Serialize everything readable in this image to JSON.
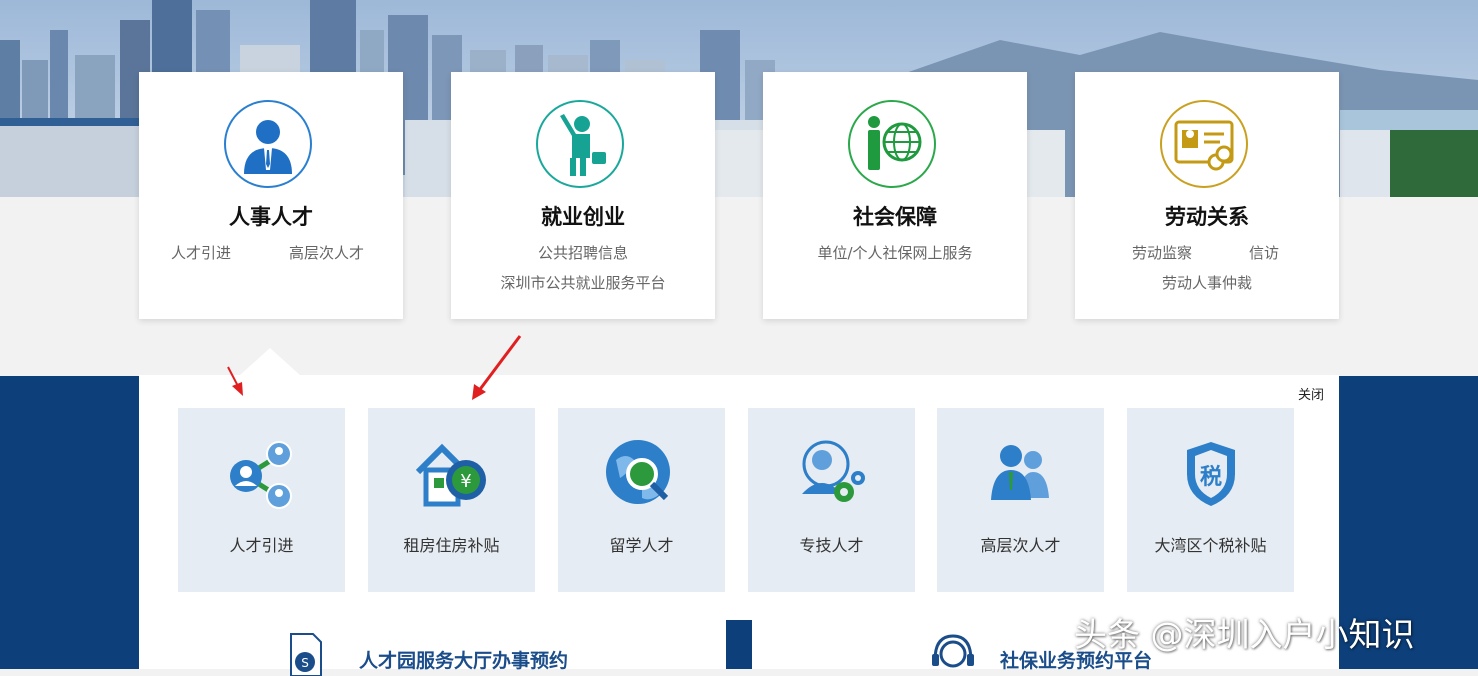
{
  "colors": {
    "navy": "#0d3f7a",
    "tile_bg": "#e6ecf3",
    "arrow_red": "#e02020"
  },
  "cards": [
    {
      "title": "人事人才",
      "links": [
        "人才引进",
        "高层次人才"
      ],
      "icon": "businessman-icon",
      "ring": "#2a7fd0"
    },
    {
      "title": "就业创业",
      "links": [
        "公共招聘信息",
        "深圳市公共就业服务平台"
      ],
      "icon": "job-seeker-icon",
      "ring": "#1aa89c"
    },
    {
      "title": "社会保障",
      "links": [
        "单位/个人社保网上服务"
      ],
      "icon": "globe-person-icon",
      "ring": "#2aa84a"
    },
    {
      "title": "劳动关系",
      "links": [
        "劳动监察",
        "信访",
        "劳动人事仲裁"
      ],
      "icon": "contract-link-icon",
      "ring": "#c9a020"
    }
  ],
  "panel": {
    "close_label": "关闭",
    "tiles": [
      {
        "label": "人才引进",
        "icon": "talent-network-icon"
      },
      {
        "label": "租房住房补贴",
        "icon": "house-subsidy-icon"
      },
      {
        "label": "留学人才",
        "icon": "globe-search-icon"
      },
      {
        "label": "专技人才",
        "icon": "technician-gear-icon"
      },
      {
        "label": "高层次人才",
        "icon": "senior-talent-icon"
      },
      {
        "label": "大湾区个税补贴",
        "icon": "tax-shield-icon"
      }
    ]
  },
  "bottom": {
    "left_label": "人才园服务大厅办事预约",
    "right_label": "社保业务预约平台"
  },
  "watermark": "头条 @深圳入户小知识"
}
